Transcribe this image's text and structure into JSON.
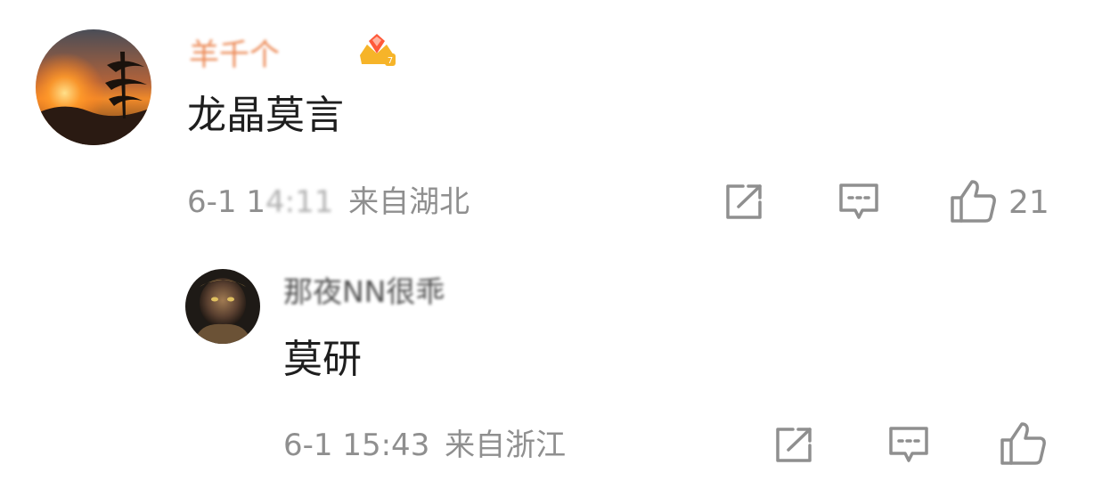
{
  "comments": [
    {
      "username": "羊千个",
      "badge_icon": "crown-diamond-badge-icon",
      "text": "龙晶莫言",
      "time": "6-1 1",
      "time_obscured": "4:11",
      "location": "来自湖北",
      "actions": {
        "share_icon": "share-icon",
        "reply_icon": "comment-icon",
        "like_icon": "thumbs-up-icon"
      },
      "like_count": "21"
    }
  ],
  "replies": [
    {
      "username": "那夜NN很乖",
      "text": "莫研",
      "time": "6-1 15:43",
      "location": "来自浙江",
      "actions": {
        "share_icon": "share-icon",
        "reply_icon": "comment-icon",
        "like_icon": "thumbs-up-icon"
      }
    }
  ],
  "colors": {
    "meta_gray": "#8f8f8f",
    "text_dark": "#1e1e1e",
    "username_orange": "#e8763a"
  }
}
